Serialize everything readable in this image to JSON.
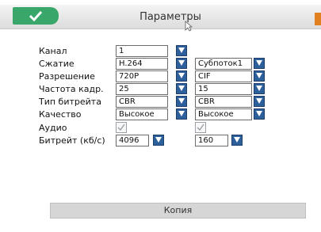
{
  "window": {
    "title": "Параметры"
  },
  "colors": {
    "accent_green": "#3aa76a",
    "dropdown_blue": "#2d5f9b",
    "corner_orange": "#e0801f"
  },
  "icons": {
    "confirm": "checkmark-icon",
    "dropdown": "down-triangle-icon"
  },
  "rows": {
    "channel": {
      "label": "Канал",
      "main": "1"
    },
    "compression": {
      "label": "Сжатие",
      "main": "H.264",
      "sub": "Субпоток1"
    },
    "resolution": {
      "label": "Разрешение",
      "main": "720P",
      "sub": "CIF"
    },
    "framerate": {
      "label": "Частота кадр.",
      "main": "25",
      "sub": "15"
    },
    "bitrate_type": {
      "label": "Тип битрейта",
      "main": "CBR",
      "sub": "CBR"
    },
    "quality": {
      "label": "Качество",
      "main": "Высокое",
      "sub": "Высокое"
    },
    "audio": {
      "label": "Аудио",
      "main_checked": true,
      "sub_checked": true
    },
    "bitrate": {
      "label": "Битрейт (кб/с)",
      "main": "4096",
      "sub": "160"
    }
  },
  "buttons": {
    "copy": "Копия"
  }
}
